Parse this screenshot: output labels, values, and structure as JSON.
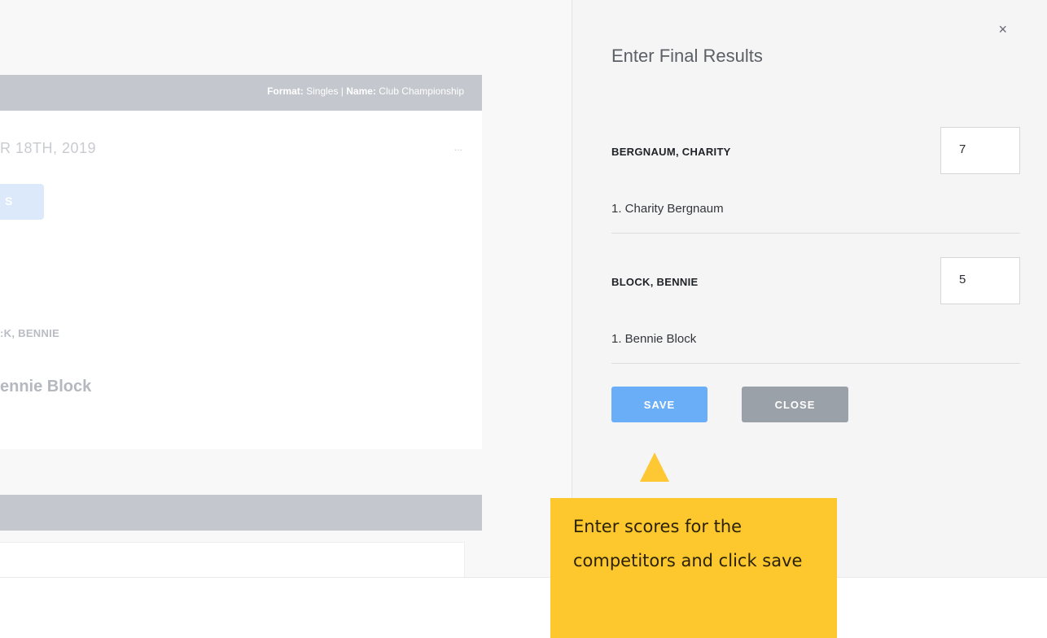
{
  "background": {
    "meta_format_label": "Format:",
    "meta_format_value": " Singles | ",
    "meta_name_label": "Name:",
    "meta_name_value": " Club Championship",
    "date_partial": "R 18TH, 2019",
    "ellipsis": "...",
    "chip_partial": "S",
    "name_upper_partial": ":K, BENNIE",
    "name_lower_partial": "ennie Block"
  },
  "modal": {
    "title": "Enter Final Results",
    "close_glyph": "×",
    "competitors": [
      {
        "name": "BERGNAUM, CHARITY",
        "score": "7",
        "player": "1. Charity Bergnaum"
      },
      {
        "name": "BLOCK, BENNIE",
        "score": "5",
        "player": "1. Bennie Block"
      }
    ],
    "save_label": "SAVE",
    "close_label": "CLOSE"
  },
  "callout": {
    "text": "Enter scores for the competitors and click save"
  },
  "colors": {
    "accent": "#6aaef7",
    "callout": "#fdc82d",
    "secondary_button": "#9aa1a9"
  },
  "icons": {
    "modal_close": "close-icon",
    "callout_pointer": "arrow-up-icon"
  }
}
